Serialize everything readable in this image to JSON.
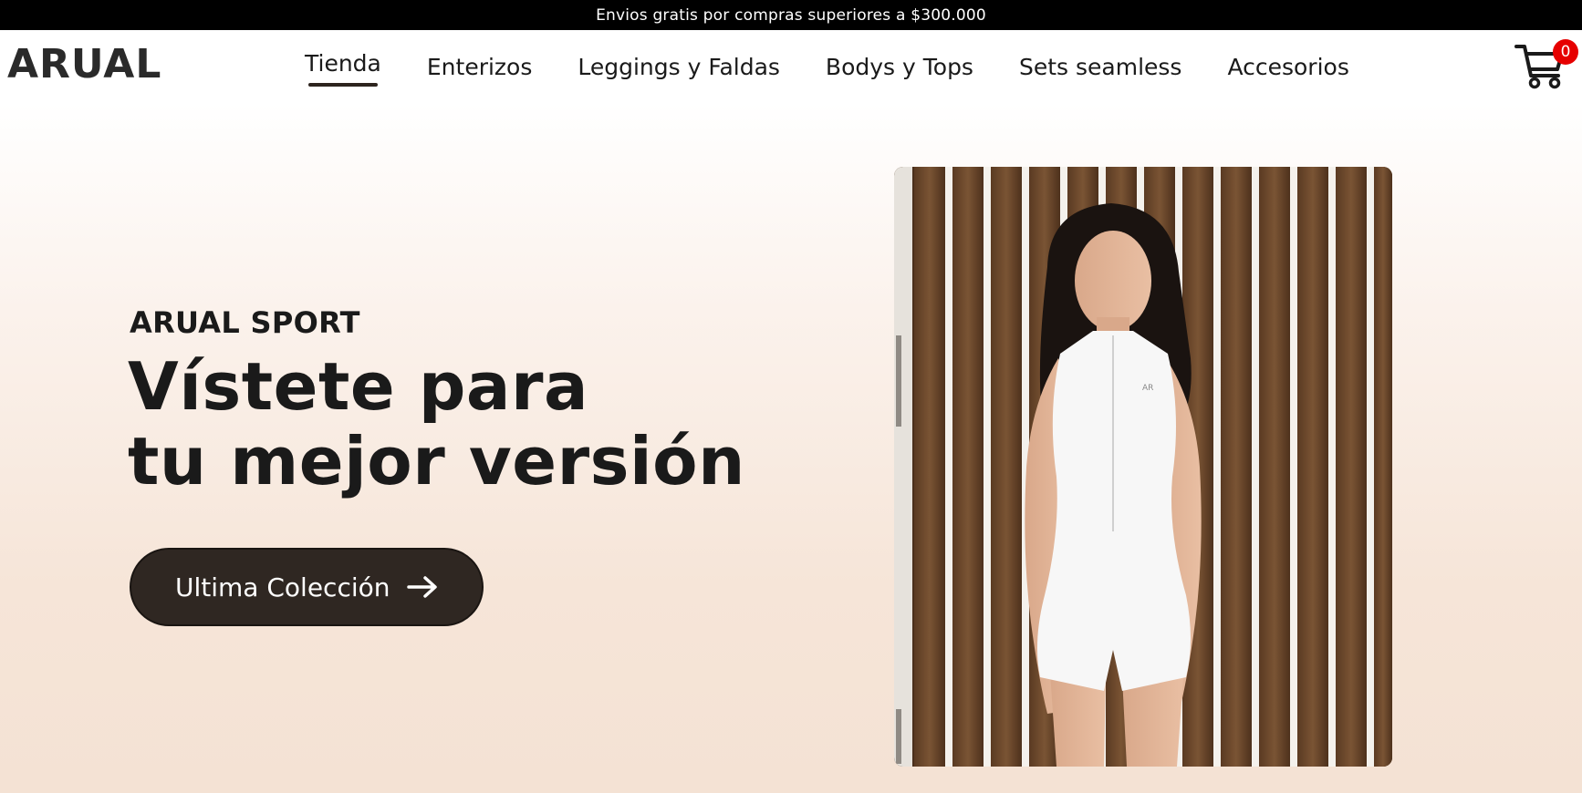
{
  "promo": {
    "text": "Envios gratis por compras superiores a $300.000"
  },
  "header": {
    "logo": "ARUAL",
    "nav": [
      {
        "label": "Tienda",
        "active": true
      },
      {
        "label": "Enterizos"
      },
      {
        "label": "Leggings y Faldas"
      },
      {
        "label": "Bodys y Tops"
      },
      {
        "label": "Sets seamless"
      },
      {
        "label": "Accesorios"
      }
    ],
    "cart": {
      "icon": "cart-icon",
      "count": "0"
    }
  },
  "hero": {
    "eyebrow": "ARUAL SPORT",
    "headline_line1": "Vístete para",
    "headline_line2": "tu mejor versión",
    "cta_label": "Ultima Colección",
    "cta_icon": "arrow-right-icon",
    "image_alt": "model-in-white-bodysuit"
  },
  "colors": {
    "promo_bg": "#000000",
    "cta_bg": "#2f2722",
    "badge": "#e60000",
    "hero_bg": "#f5e6da"
  }
}
